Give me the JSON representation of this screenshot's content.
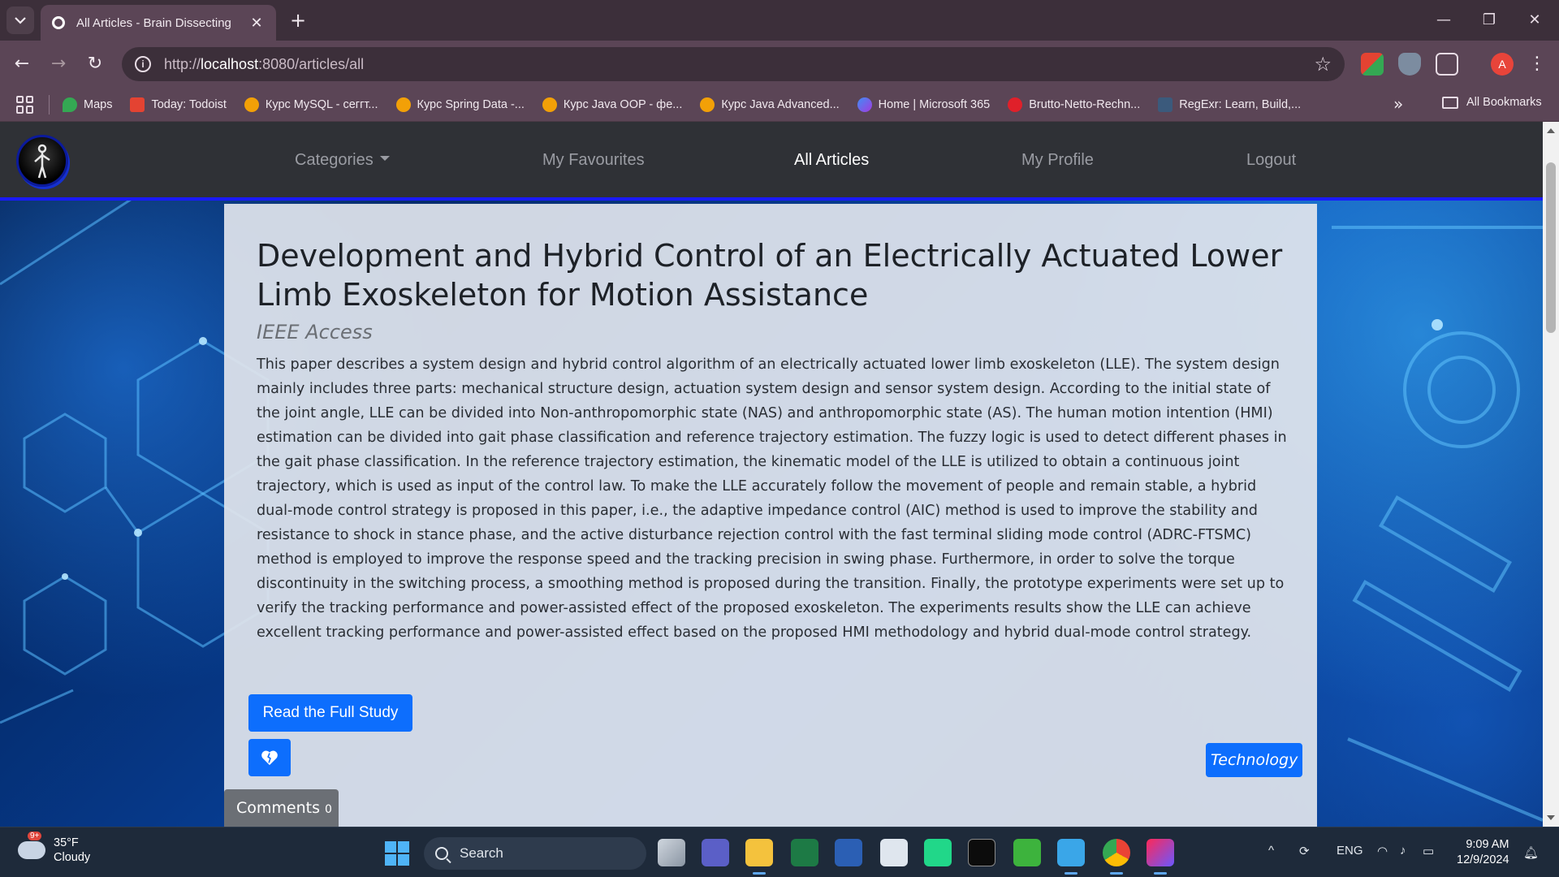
{
  "browser": {
    "tab_title": "All Articles - Brain Dissecting",
    "url_prefix": "http://",
    "url_host": "localhost",
    "url_rest": ":8080/articles/all",
    "profile_initial": "A",
    "bookmarks": [
      {
        "label": "Maps",
        "color": "#34a853"
      },
      {
        "label": "Today: Todoist",
        "color": "#e44332"
      },
      {
        "label": "Курс MySQL - сеггт...",
        "color": "#f2a007"
      },
      {
        "label": "Курс Spring Data -...",
        "color": "#f2a007"
      },
      {
        "label": "Курс Java OOP - фе...",
        "color": "#f2a007"
      },
      {
        "label": "Курс Java Advanced...",
        "color": "#f2a007"
      },
      {
        "label": "Home | Microsoft 365",
        "color": "#6a5bd6"
      },
      {
        "label": "Brutto-Netto-Rechn...",
        "color": "#e0202a"
      },
      {
        "label": "RegExr: Learn, Build,...",
        "color": "#3b5a7c"
      }
    ],
    "all_bookmarks": "All Bookmarks"
  },
  "site": {
    "nav": {
      "categories": "Categories",
      "favourites": "My Favourites",
      "all_articles": "All Articles",
      "profile": "My Profile",
      "logout": "Logout"
    },
    "article": {
      "title": "Development and Hybrid Control of an Electrically Actuated Lower Limb Exoskeleton for Motion Assistance",
      "journal": "IEEE Access",
      "abstract": "This paper describes a system design and hybrid control algorithm of an electrically actuated lower limb exoskeleton (LLE). The system design mainly includes three parts: mechanical structure design, actuation system design and sensor system design. According to the initial state of the joint angle, LLE can be divided into Non-anthropomorphic state (NAS) and anthropomorphic state (AS). The human motion intention (HMI) estimation can be divided into gait phase classification and reference trajectory estimation. The fuzzy logic is used to detect different phases in the gait phase classification. In the reference trajectory estimation, the kinematic model of the LLE is utilized to obtain a continuous joint trajectory, which is used as input of the control law. To make the LLE accurately follow the movement of people and remain stable, a hybrid dual-mode control strategy is proposed in this paper, i.e., the adaptive impedance control (AIC) method is used to improve the stability and resistance to shock in stance phase, and the active disturbance rejection control with the fast terminal sliding mode control (ADRC-FTSMC) method is employed to improve the response speed and the tracking precision in swing phase. Furthermore, in order to solve the torque discontinuity in the switching process, a smoothing method is proposed during the transition. Finally, the prototype experiments were set up to verify the tracking performance and power-assisted effect of the proposed exoskeleton. The experiments results show the LLE can achieve excellent tracking performance and power-assisted effect based on the proposed HMI methodology and hybrid dual-mode control strategy.",
      "read_button": "Read the Full Study",
      "category_tag": "Technology",
      "comments_label": "Comments",
      "comments_count": "0"
    }
  },
  "taskbar": {
    "weather_badge": "9+",
    "temperature": "35°F",
    "condition": "Cloudy",
    "search_placeholder": "Search",
    "language": "ENG",
    "time": "9:09 AM",
    "date": "12/9/2024"
  },
  "colors": {
    "accent_blue": "#0d6efd",
    "nav_bg": "#2f3136",
    "chrome_frame": "#5b4556"
  }
}
